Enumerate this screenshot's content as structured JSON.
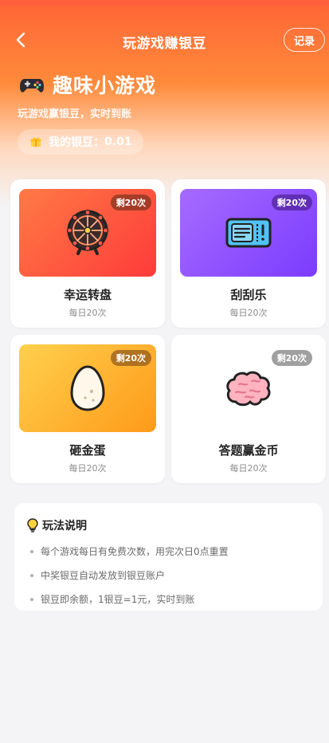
{
  "nav": {
    "title": "玩游戏赚银豆",
    "record_label": "记录",
    "back_icon": "chevron-left-icon"
  },
  "hero": {
    "headline": "趣味小游戏",
    "subtitle": "玩游戏赢银豆，实时到账",
    "balance_label": "我的银豆：",
    "balance_value": "0.01",
    "icons": [
      "gamepad-icon",
      "gift-icon"
    ]
  },
  "games": [
    {
      "name": "幸运转盘",
      "limit": "每日20次",
      "remaining": "剩20次",
      "icon": "ferris-wheel-icon",
      "accent": "#ff5a3d"
    },
    {
      "name": "刮刮乐",
      "limit": "每日20次",
      "remaining": "剩20次",
      "icon": "ticket-icon",
      "accent": "#8b4dff"
    },
    {
      "name": "砸金蛋",
      "limit": "每日20次",
      "remaining": "剩20次",
      "icon": "egg-icon",
      "accent": "#ffb52e"
    },
    {
      "name": "答题赢金币",
      "limit": "每日20次",
      "remaining": "剩20次",
      "icon": "brain-icon",
      "accent": "#ff8fa3"
    }
  ],
  "rules": {
    "title": "玩法说明",
    "icon": "lightbulb-icon",
    "items": [
      "每个游戏每日有免费次数，用完次日0点重置",
      "中奖银豆自动发放到银豆账户",
      "银豆即余额，1银豆=1元，实时到账"
    ]
  }
}
